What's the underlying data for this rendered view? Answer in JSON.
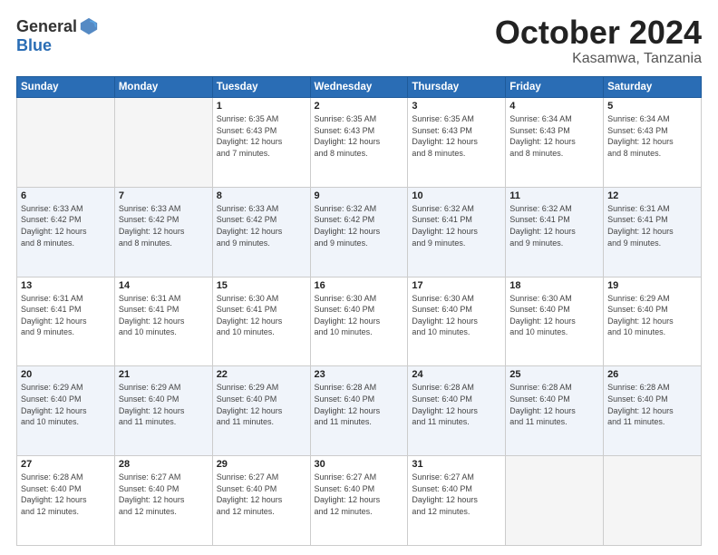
{
  "header": {
    "logo_general": "General",
    "logo_blue": "Blue",
    "month": "October 2024",
    "location": "Kasamwa, Tanzania"
  },
  "days_of_week": [
    "Sunday",
    "Monday",
    "Tuesday",
    "Wednesday",
    "Thursday",
    "Friday",
    "Saturday"
  ],
  "weeks": [
    [
      {
        "day": "",
        "info": ""
      },
      {
        "day": "",
        "info": ""
      },
      {
        "day": "1",
        "info": "Sunrise: 6:35 AM\nSunset: 6:43 PM\nDaylight: 12 hours\nand 7 minutes."
      },
      {
        "day": "2",
        "info": "Sunrise: 6:35 AM\nSunset: 6:43 PM\nDaylight: 12 hours\nand 8 minutes."
      },
      {
        "day": "3",
        "info": "Sunrise: 6:35 AM\nSunset: 6:43 PM\nDaylight: 12 hours\nand 8 minutes."
      },
      {
        "day": "4",
        "info": "Sunrise: 6:34 AM\nSunset: 6:43 PM\nDaylight: 12 hours\nand 8 minutes."
      },
      {
        "day": "5",
        "info": "Sunrise: 6:34 AM\nSunset: 6:43 PM\nDaylight: 12 hours\nand 8 minutes."
      }
    ],
    [
      {
        "day": "6",
        "info": "Sunrise: 6:33 AM\nSunset: 6:42 PM\nDaylight: 12 hours\nand 8 minutes."
      },
      {
        "day": "7",
        "info": "Sunrise: 6:33 AM\nSunset: 6:42 PM\nDaylight: 12 hours\nand 8 minutes."
      },
      {
        "day": "8",
        "info": "Sunrise: 6:33 AM\nSunset: 6:42 PM\nDaylight: 12 hours\nand 9 minutes."
      },
      {
        "day": "9",
        "info": "Sunrise: 6:32 AM\nSunset: 6:42 PM\nDaylight: 12 hours\nand 9 minutes."
      },
      {
        "day": "10",
        "info": "Sunrise: 6:32 AM\nSunset: 6:41 PM\nDaylight: 12 hours\nand 9 minutes."
      },
      {
        "day": "11",
        "info": "Sunrise: 6:32 AM\nSunset: 6:41 PM\nDaylight: 12 hours\nand 9 minutes."
      },
      {
        "day": "12",
        "info": "Sunrise: 6:31 AM\nSunset: 6:41 PM\nDaylight: 12 hours\nand 9 minutes."
      }
    ],
    [
      {
        "day": "13",
        "info": "Sunrise: 6:31 AM\nSunset: 6:41 PM\nDaylight: 12 hours\nand 9 minutes."
      },
      {
        "day": "14",
        "info": "Sunrise: 6:31 AM\nSunset: 6:41 PM\nDaylight: 12 hours\nand 10 minutes."
      },
      {
        "day": "15",
        "info": "Sunrise: 6:30 AM\nSunset: 6:41 PM\nDaylight: 12 hours\nand 10 minutes."
      },
      {
        "day": "16",
        "info": "Sunrise: 6:30 AM\nSunset: 6:40 PM\nDaylight: 12 hours\nand 10 minutes."
      },
      {
        "day": "17",
        "info": "Sunrise: 6:30 AM\nSunset: 6:40 PM\nDaylight: 12 hours\nand 10 minutes."
      },
      {
        "day": "18",
        "info": "Sunrise: 6:30 AM\nSunset: 6:40 PM\nDaylight: 12 hours\nand 10 minutes."
      },
      {
        "day": "19",
        "info": "Sunrise: 6:29 AM\nSunset: 6:40 PM\nDaylight: 12 hours\nand 10 minutes."
      }
    ],
    [
      {
        "day": "20",
        "info": "Sunrise: 6:29 AM\nSunset: 6:40 PM\nDaylight: 12 hours\nand 10 minutes."
      },
      {
        "day": "21",
        "info": "Sunrise: 6:29 AM\nSunset: 6:40 PM\nDaylight: 12 hours\nand 11 minutes."
      },
      {
        "day": "22",
        "info": "Sunrise: 6:29 AM\nSunset: 6:40 PM\nDaylight: 12 hours\nand 11 minutes."
      },
      {
        "day": "23",
        "info": "Sunrise: 6:28 AM\nSunset: 6:40 PM\nDaylight: 12 hours\nand 11 minutes."
      },
      {
        "day": "24",
        "info": "Sunrise: 6:28 AM\nSunset: 6:40 PM\nDaylight: 12 hours\nand 11 minutes."
      },
      {
        "day": "25",
        "info": "Sunrise: 6:28 AM\nSunset: 6:40 PM\nDaylight: 12 hours\nand 11 minutes."
      },
      {
        "day": "26",
        "info": "Sunrise: 6:28 AM\nSunset: 6:40 PM\nDaylight: 12 hours\nand 11 minutes."
      }
    ],
    [
      {
        "day": "27",
        "info": "Sunrise: 6:28 AM\nSunset: 6:40 PM\nDaylight: 12 hours\nand 12 minutes."
      },
      {
        "day": "28",
        "info": "Sunrise: 6:27 AM\nSunset: 6:40 PM\nDaylight: 12 hours\nand 12 minutes."
      },
      {
        "day": "29",
        "info": "Sunrise: 6:27 AM\nSunset: 6:40 PM\nDaylight: 12 hours\nand 12 minutes."
      },
      {
        "day": "30",
        "info": "Sunrise: 6:27 AM\nSunset: 6:40 PM\nDaylight: 12 hours\nand 12 minutes."
      },
      {
        "day": "31",
        "info": "Sunrise: 6:27 AM\nSunset: 6:40 PM\nDaylight: 12 hours\nand 12 minutes."
      },
      {
        "day": "",
        "info": ""
      },
      {
        "day": "",
        "info": ""
      }
    ]
  ]
}
